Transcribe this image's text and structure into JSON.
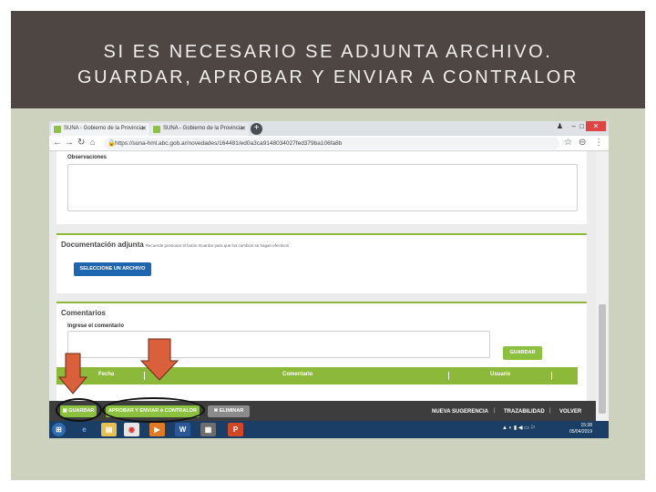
{
  "slide": {
    "title_line1": "SI ES NECESARIO SE ADJUNTA ARCHIVO.",
    "title_line2": "GUARDAR, APROBAR Y ENVIAR A CONTRALOR"
  },
  "browser": {
    "tabs": [
      {
        "label": "SUNA - Gobierno de la Provincia"
      },
      {
        "label": "SUNA - Gobierno de la Provincia"
      }
    ],
    "url": "https://suna-hml.abc.gob.ar/novedades/164481/ed0a3ca9148034027fed379ba106fa8b"
  },
  "form": {
    "observaciones_label": "Observaciones",
    "documentacion_title": "Documentación adjunta",
    "documentacion_note": "Recuerde presionar el botón Guardar para que los cambios se hagan efectivos",
    "select_file_button": "SELECCIONE UN ARCHIVO",
    "comentarios_title": "Comentarios",
    "comment_label": "Ingrese el comentario",
    "guardar_comment_button": "GUARDAR",
    "table_headers": [
      "Fecha",
      "Comentario",
      "Usuario"
    ]
  },
  "action_bar": {
    "guardar": "GUARDAR",
    "aprobar": "APROBAR Y ENVIAR A CONTRALOR",
    "eliminar": "ELIMINAR",
    "nueva_sugerencia": "NUEVA SUGERENCIA",
    "trazabilidad": "TRAZABILIDAD",
    "volver": "VOLVER"
  },
  "taskbar": {
    "time": "15:38",
    "date": "05/04/2019"
  },
  "colors": {
    "header_bg": "#4e4643",
    "slide_bg": "#cdd2bf",
    "green": "#8cb93a",
    "blue": "#1f66b0",
    "arrow": "#d9603b"
  }
}
